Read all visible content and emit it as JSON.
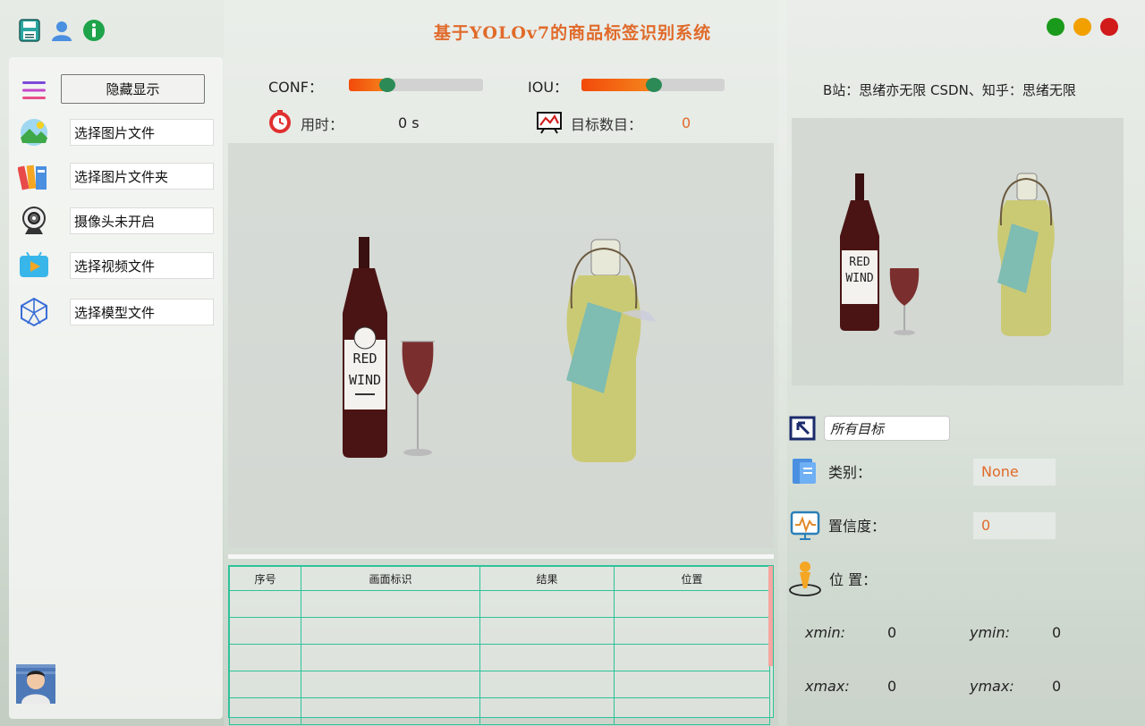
{
  "title": "基于YOLOv7的商品标签识别系统",
  "colors": {
    "accent": "#e06a2a",
    "table_border": "#2ec29a",
    "slider_fill": "#f24a0a",
    "slider_knob": "#2b8a55",
    "win_close": "#d11a1a",
    "win_min": "#f2a000",
    "win_max": "#1a9a1a"
  },
  "top_icons": [
    "save-icon",
    "user-icon",
    "info-icon"
  ],
  "sidebar": {
    "hide_button": "隐藏显示",
    "items": [
      {
        "label": "选择图片文件",
        "icon": "image-icon"
      },
      {
        "label": "选择图片文件夹",
        "icon": "folder-icon"
      },
      {
        "label": "摄像头未开启",
        "icon": "camera-icon"
      },
      {
        "label": "选择视频文件",
        "icon": "video-icon"
      },
      {
        "label": "选择模型文件",
        "icon": "model-icon"
      }
    ]
  },
  "params": {
    "conf_label": "CONF：",
    "conf_value": 0.25,
    "iou_label": "IOU：",
    "iou_value": 0.5,
    "time_label": "用时：",
    "time_value": "0 s",
    "count_label": "目标数目：",
    "count_value": "0"
  },
  "table": {
    "headers": [
      "序号",
      "画面标识",
      "结果",
      "位置"
    ],
    "rows": [
      [
        "",
        "",
        "",
        ""
      ],
      [
        "",
        "",
        "",
        ""
      ],
      [
        "",
        "",
        "",
        ""
      ],
      [
        "",
        "",
        "",
        ""
      ],
      [
        "",
        "",
        "",
        ""
      ]
    ]
  },
  "right": {
    "slogan": "B站：思绪亦无限  CSDN、知乎：思绪无限",
    "target_select": "所有目标",
    "class_label": "类别：",
    "class_value": "None",
    "conf_label": "置信度：",
    "conf_value": "0",
    "pos_label": "位 置：",
    "xmin_label": "xmin:",
    "xmin": "0",
    "ymin_label": "ymin:",
    "ymin": "0",
    "xmax_label": "xmax:",
    "xmax": "0",
    "ymax_label": "ymax:",
    "ymax": "0"
  },
  "image_text": {
    "bottle_label_line1": "RED",
    "bottle_label_line2": "WIND"
  }
}
